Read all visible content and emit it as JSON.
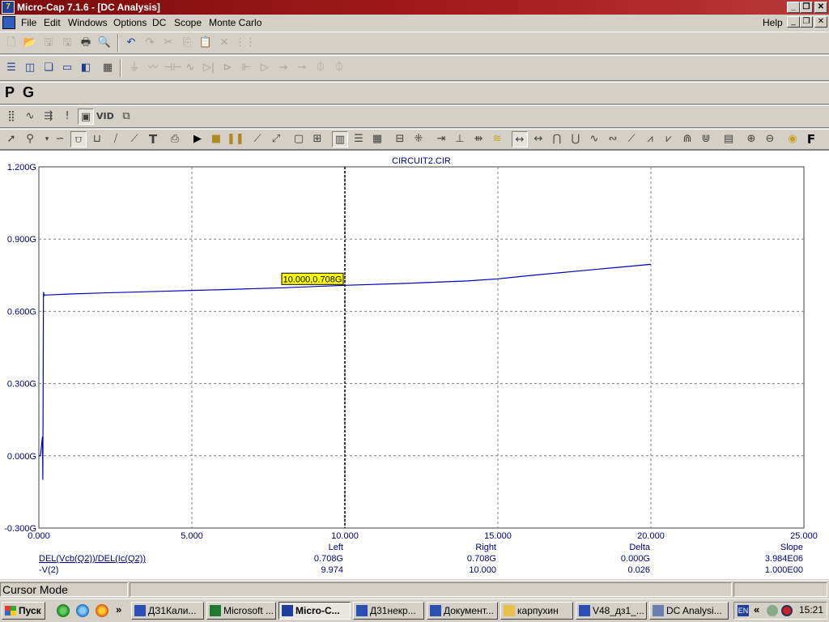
{
  "window": {
    "title": "Micro-Cap 7.1.6 - [DC Analysis]",
    "app_icon_label": "7"
  },
  "menu": {
    "items": [
      "File",
      "Edit",
      "Windows",
      "Options",
      "DC",
      "Scope",
      "Monte Carlo"
    ],
    "help": "Help"
  },
  "toolbar3": {
    "p_label": "P",
    "g_label": "G"
  },
  "chart_data": {
    "type": "line",
    "title": "CIRCUIT2.CIR",
    "xlim": [
      0,
      25
    ],
    "ylim": [
      -0.3,
      1.2
    ],
    "x_ticks": [
      "0.000",
      "5.000",
      "10.000",
      "15.000",
      "20.000",
      "25.000"
    ],
    "y_ticks": [
      "1.200G",
      "0.900G",
      "0.600G",
      "0.300G",
      "0.000G",
      "-0.300G"
    ],
    "grid": true,
    "series": [
      {
        "color": "#0000c0",
        "x": [
          0.0,
          0.05,
          0.08,
          0.1,
          0.12,
          0.13,
          0.15,
          0.17,
          0.2,
          0.3,
          1,
          2,
          4,
          6,
          8,
          10,
          12,
          14,
          15,
          16,
          18,
          20
        ],
        "y": [
          0.0,
          0.0,
          0.03,
          0.06,
          0.08,
          -0.1,
          0.68,
          0.665,
          0.668,
          0.668,
          0.672,
          0.676,
          0.683,
          0.69,
          0.698,
          0.708,
          0.716,
          0.726,
          0.735,
          0.748,
          0.772,
          0.795
        ]
      }
    ],
    "cursor": {
      "x": 10.0,
      "label": "10.000,0.708G"
    }
  },
  "readout": {
    "headers": {
      "left": "Left",
      "right": "Right",
      "delta": "Delta",
      "slope": "Slope"
    },
    "rows": [
      {
        "name": "DEL(Vcb(Q2))/DEL(Ic(Q2))",
        "left": "0.708G",
        "right": "0.708G",
        "delta": "0.000G",
        "slope": "3.984E06"
      },
      {
        "name": "-V(2)",
        "left": "9.974",
        "right": "10.000",
        "delta": "0.026",
        "slope": "1.000E00"
      }
    ]
  },
  "status": {
    "mode": "Cursor Mode"
  },
  "taskbar": {
    "start": "Пуск",
    "more": "»",
    "tasks": [
      {
        "label": "ДЗ1Кали...",
        "icon": "word-icon"
      },
      {
        "label": "Microsoft ...",
        "icon": "excel-icon"
      },
      {
        "label": "Micro-C...",
        "icon": "microcap-icon",
        "active": true
      },
      {
        "label": "Д31некр...",
        "icon": "word-icon"
      },
      {
        "label": "Документ...",
        "icon": "word-icon"
      },
      {
        "label": "карпухин",
        "icon": "folder-icon"
      },
      {
        "label": "V48_дз1_...",
        "icon": "word-icon"
      },
      {
        "label": "DC Analysi...",
        "icon": "document-icon"
      }
    ],
    "lang": "EN",
    "tray_more": "«",
    "clock": "15:21"
  }
}
